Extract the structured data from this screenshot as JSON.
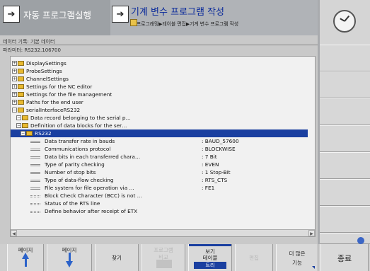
{
  "header": {
    "mode_label": "자동 프로그램실행",
    "edit_title": "기계 변수 프로그램 작성",
    "breadcrumb": "프로그래밍▶테이블 편집▶기계 변수 프로그램 작성"
  },
  "info": {
    "line1": "데이터 기록: 기본 데이터",
    "line2": "파라미터: RS232.106700"
  },
  "tree": [
    {
      "kind": "folder",
      "depth": 0,
      "label": "DisplaySettings"
    },
    {
      "kind": "folder",
      "depth": 0,
      "label": "ProbeSettings"
    },
    {
      "kind": "folder",
      "depth": 0,
      "label": "ChannelSettings"
    },
    {
      "kind": "folder",
      "depth": 0,
      "label": "Settings for the NC editor"
    },
    {
      "kind": "folder",
      "depth": 0,
      "label": "Settings for the file management"
    },
    {
      "kind": "folder",
      "depth": 0,
      "label": "Paths for the end user"
    },
    {
      "kind": "folder",
      "depth": 0,
      "label": "serialInterfaceRS232"
    },
    {
      "kind": "folder",
      "depth": 1,
      "label": "Data record belonging to the serial p…"
    },
    {
      "kind": "folder",
      "depth": 1,
      "label": "Definition of data blocks for the ser…"
    },
    {
      "kind": "folder",
      "depth": 2,
      "label": "RS232",
      "selected": true
    },
    {
      "kind": "leaf",
      "depth": 3,
      "label": "Data transfer rate in bauds",
      "value": ": BAUD_57600"
    },
    {
      "kind": "leaf",
      "depth": 3,
      "label": "Communications protocol",
      "value": ": BLOCKWISE"
    },
    {
      "kind": "leaf",
      "depth": 3,
      "label": "Data bits in each transferred chara…",
      "value": ": 7 Bit"
    },
    {
      "kind": "leaf",
      "depth": 3,
      "label": "Type of parity checking",
      "value": ": EVEN"
    },
    {
      "kind": "leaf",
      "depth": 3,
      "label": "Number of stop bits",
      "value": ": 1 Stop-Bit"
    },
    {
      "kind": "leaf",
      "depth": 3,
      "label": "Type of data-flow checking",
      "value": ": RTS_CTS"
    },
    {
      "kind": "leaf",
      "depth": 3,
      "label": "File system for file operation via …",
      "value": ": FE1"
    },
    {
      "kind": "leafdot",
      "depth": 3,
      "label": "Block Check Character (BCC) is not …",
      "value": ""
    },
    {
      "kind": "leafdot",
      "depth": 3,
      "label": "Status of the RTS line",
      "value": ""
    },
    {
      "kind": "leafdot",
      "depth": 3,
      "label": "Define behavior after receipt of ETX",
      "value": ""
    }
  ],
  "softkeys": {
    "page_up": "페이지",
    "page_down": "페이지",
    "find": "찾기",
    "disabled_top": "프로그램",
    "disabled_bottom": "비교",
    "view_line1": "보기",
    "view_line2": "테이블",
    "view_selected": "트리",
    "disabled2": "편집",
    "more_line1": "더 많은",
    "more_line2": "기능",
    "end": "종료"
  }
}
